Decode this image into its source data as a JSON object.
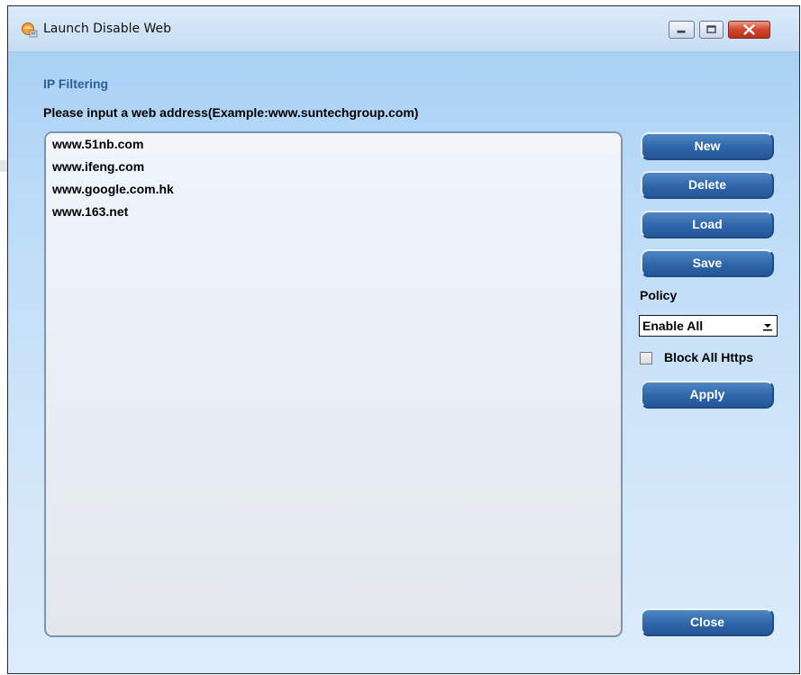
{
  "window": {
    "title": "Launch Disable Web"
  },
  "titlebar_buttons": {
    "minimize_icon": "minimize-icon",
    "maximize_icon": "maximize-icon",
    "close_icon": "close-icon"
  },
  "section": {
    "title": "IP Filtering",
    "instruction": "Please input a web address(Example:www.suntechgroup.com)"
  },
  "addresses": [
    "www.51nb.com",
    "www.ifeng.com",
    "www.google.com.hk",
    "www.163.net"
  ],
  "buttons": {
    "new": "New",
    "delete": "Delete",
    "load": "Load",
    "save": "Save",
    "apply": "Apply",
    "close": "Close"
  },
  "policy": {
    "label": "Policy",
    "selected": "Enable All"
  },
  "block_https": {
    "label": "Block All Https",
    "checked": false
  },
  "colors": {
    "button_fill": "#2f66aa",
    "section_title": "#2a5f9c",
    "close_button": "#d1452c"
  }
}
